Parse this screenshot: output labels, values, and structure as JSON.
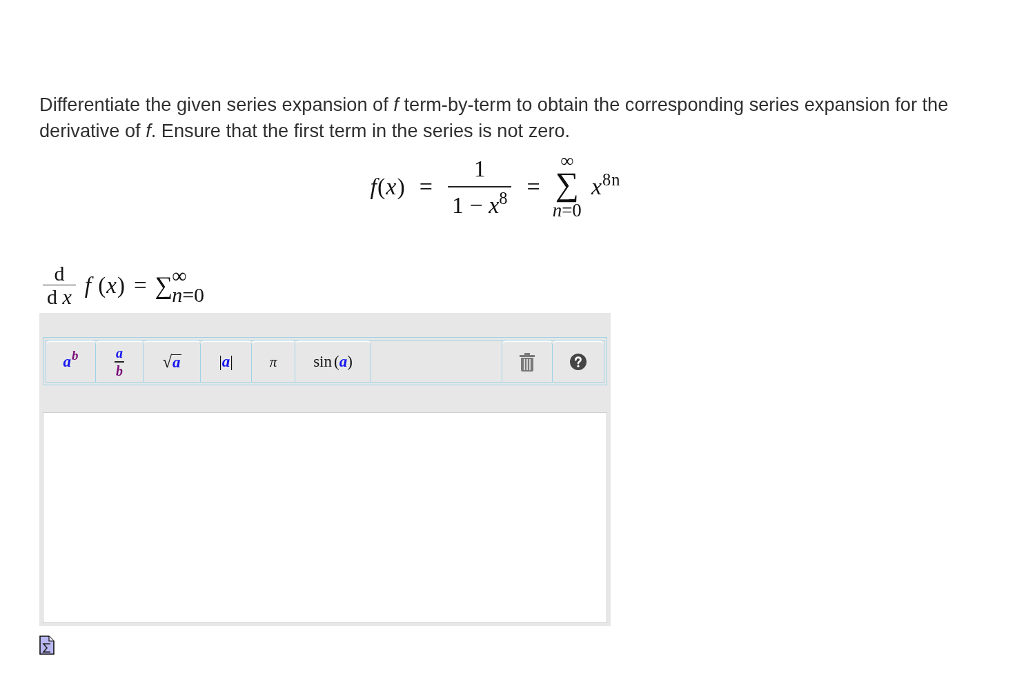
{
  "question": {
    "text": "Differentiate the given series expansion of *f* term-by-term to obtain the corresponding series expansion for the derivative of *f*. Ensure that the first term in the series is not zero."
  },
  "given_series": {
    "terms": [
      {
        "kind": "text",
        "text": "*f*(*x*)"
      },
      {
        "kind": "relation",
        "text": "="
      },
      {
        "kind": "fraction",
        "numerator": "1",
        "denominator": "1 − *x*$^{8}$"
      },
      {
        "kind": "relation",
        "text": "="
      },
      {
        "kind": "sum",
        "symbol": "∑",
        "upper": "∞",
        "lower": "*n*=0"
      },
      {
        "kind": "text",
        "text": "*x*$^{8n}$"
      }
    ]
  },
  "answer_prompt": {
    "terms": [
      {
        "kind": "fraction",
        "numerator": "d",
        "denominator": "d *x*"
      },
      {
        "kind": "text",
        "text": "*f* (*x*)"
      },
      {
        "kind": "relation",
        "text": "="
      },
      {
        "kind": "inline_sum",
        "symbol": "∑",
        "upper": "∞",
        "lower": "*n*=0"
      }
    ]
  },
  "editor": {
    "toolbar": {
      "buttons": [
        {
          "kind": "power",
          "base": "a",
          "exponent": "b"
        },
        {
          "kind": "fraction",
          "numerator": "a",
          "denominator": "b"
        },
        {
          "kind": "root",
          "sign": "√",
          "radicand": "a"
        },
        {
          "kind": "absolute",
          "left": "|",
          "argument": "a",
          "right": "|"
        },
        {
          "kind": "symbol",
          "symbol": "π"
        },
        {
          "kind": "function",
          "name": "sin",
          "open": "(",
          "argument": "a",
          "close": ")"
        }
      ],
      "actions": [
        {
          "kind": "delete"
        },
        {
          "kind": "help"
        }
      ]
    }
  }
}
